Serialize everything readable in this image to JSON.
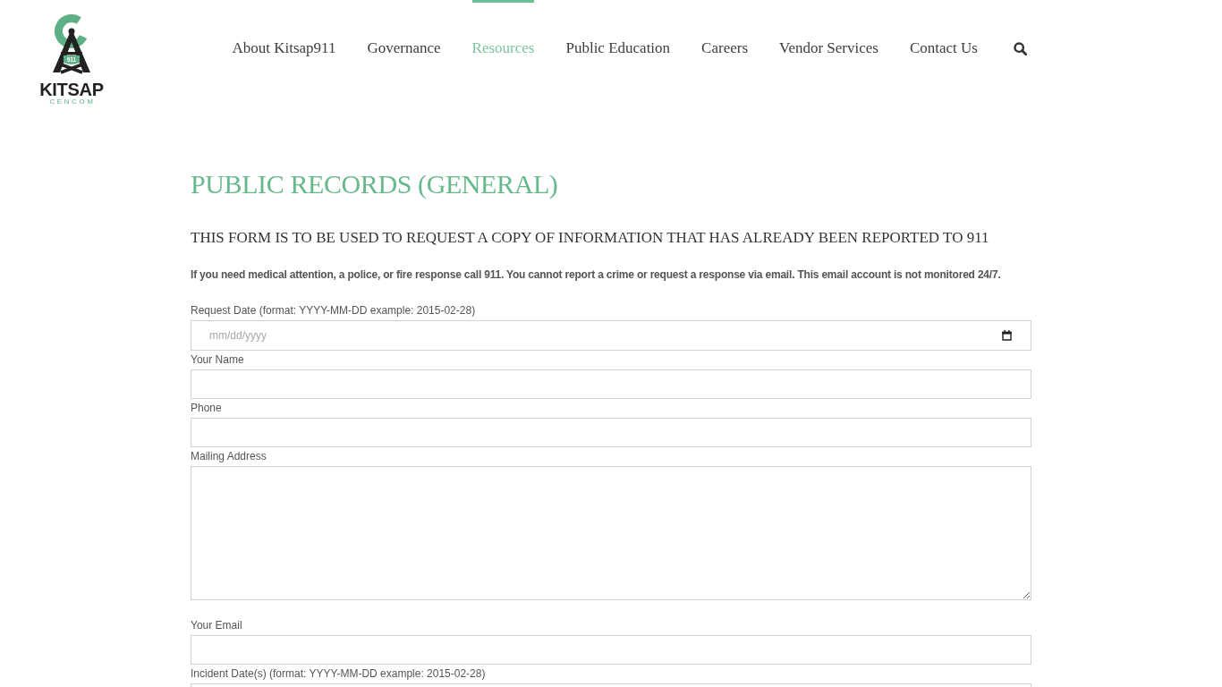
{
  "logo": {
    "badge": "911",
    "name": "KITSAP",
    "subtitle": "CENCOM"
  },
  "nav": {
    "items": [
      {
        "label": "About Kitsap911",
        "selected": false
      },
      {
        "label": "Governance",
        "selected": false
      },
      {
        "label": "Resources",
        "selected": true
      },
      {
        "label": "Public Education",
        "selected": false
      },
      {
        "label": "Careers",
        "selected": false
      },
      {
        "label": "Vendor Services",
        "selected": false
      },
      {
        "label": "Contact Us",
        "selected": false
      }
    ]
  },
  "page": {
    "title": "PUBLIC RECORDS (GENERAL)",
    "subtitle": "THIS FORM IS TO BE USED TO REQUEST A COPY OF INFORMATION THAT HAS ALREADY BEEN REPORTED TO 911",
    "notice": "If you need medical attention, a police, or fire response call 911. You cannot report a crime or request a response via email. This email account is not monitored 24/7."
  },
  "form": {
    "fields": [
      {
        "kind": "date",
        "label": "Request Date (format: YYYY-MM-DD example: 2015-02-28)",
        "placeholder": "mm/dd/yyyy"
      },
      {
        "kind": "text",
        "label": "Your Name"
      },
      {
        "kind": "text",
        "label": "Phone"
      },
      {
        "kind": "textarea",
        "label": "Mailing Address"
      },
      {
        "kind": "text",
        "label": "Your Email"
      },
      {
        "kind": "text",
        "label": "Incident Date(s) (format: YYYY-MM-DD example: 2015-02-28)"
      }
    ]
  }
}
